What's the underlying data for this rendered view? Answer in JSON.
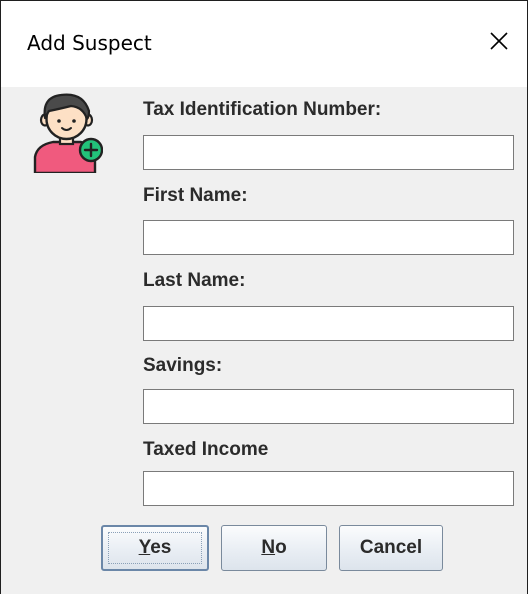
{
  "window": {
    "title": "Add Suspect",
    "close_icon": "close-icon"
  },
  "avatar": {
    "icon": "add-user-icon",
    "colors": {
      "shirt": "#f05a7e",
      "badge": "#22c27a",
      "hair": "#4a4a4a",
      "skin": "#fde0c5"
    }
  },
  "form": {
    "tax_id": {
      "label": "Tax Identification Number:",
      "value": ""
    },
    "first_name": {
      "label": "First Name:",
      "value": ""
    },
    "last_name": {
      "label": "Last Name:",
      "value": ""
    },
    "savings": {
      "label": "Savings:",
      "value": ""
    },
    "taxed_income": {
      "label": "Taxed Income",
      "value": ""
    }
  },
  "buttons": {
    "yes": {
      "mnemonic": "Y",
      "rest": "es"
    },
    "no": {
      "mnemonic": "N",
      "rest": "o"
    },
    "cancel": {
      "label": "Cancel"
    }
  }
}
